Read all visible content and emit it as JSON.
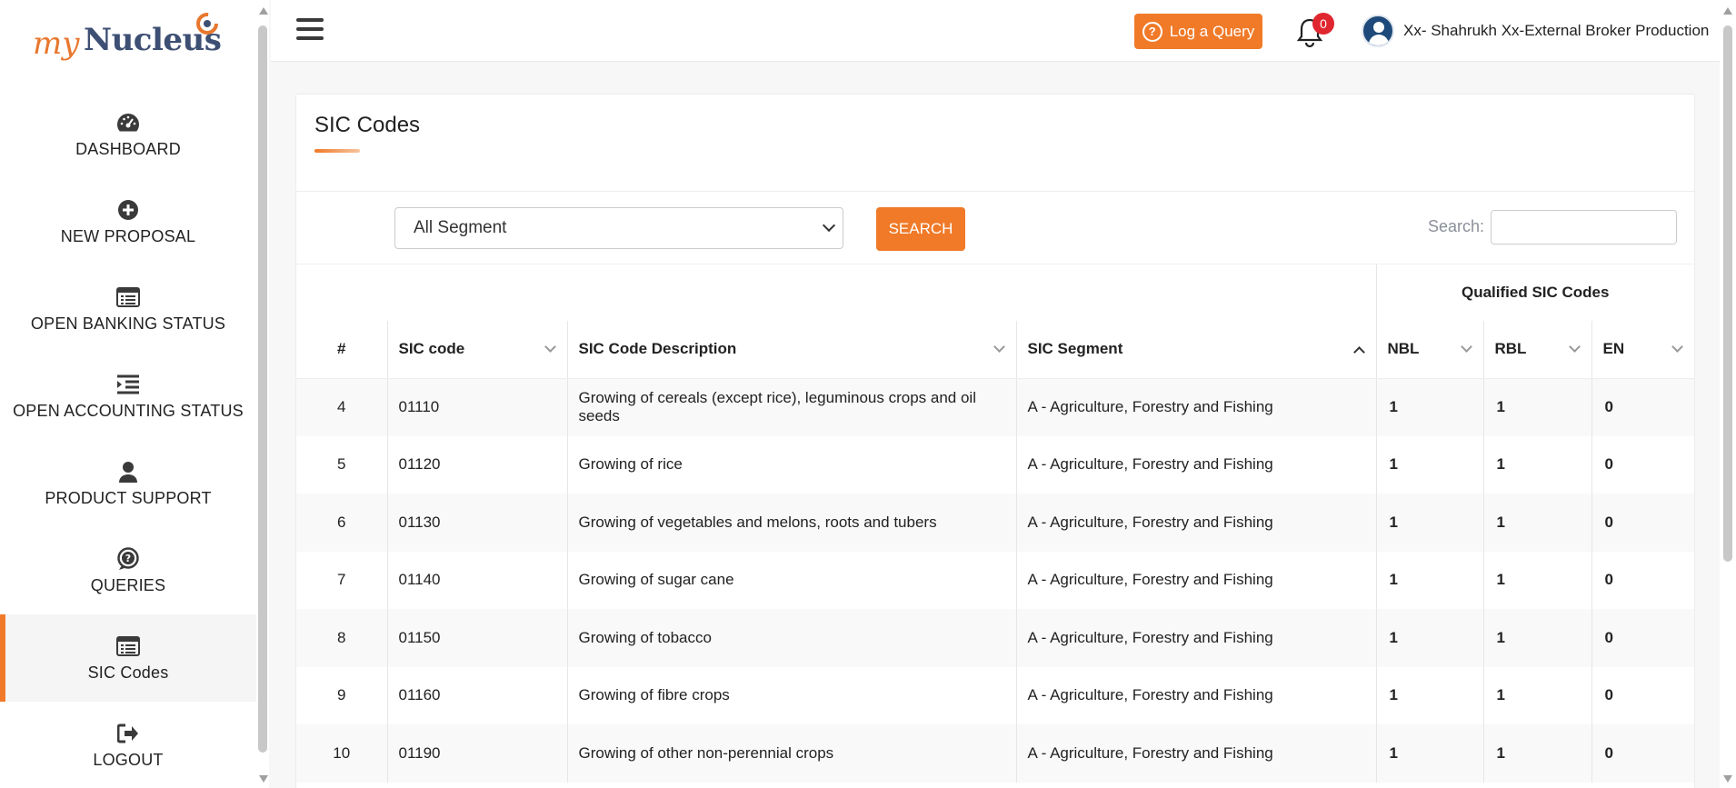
{
  "logo": {
    "part1": "my",
    "part2": "Nucleus"
  },
  "nav": [
    {
      "label": "DASHBOARD",
      "icon": "dashboard-gauge-icon",
      "active": false
    },
    {
      "label": "NEW PROPOSAL",
      "icon": "plus-circle-icon",
      "active": false
    },
    {
      "label": "OPEN BANKING STATUS",
      "icon": "list-card-icon",
      "active": false
    },
    {
      "label": "OPEN ACCOUNTING STATUS",
      "icon": "indent-list-icon",
      "active": false
    },
    {
      "label": "PRODUCT SUPPORT",
      "icon": "user-icon",
      "active": false
    },
    {
      "label": "QUERIES",
      "icon": "question-circle-icon",
      "active": false
    },
    {
      "label": "SIC Codes",
      "icon": "list-card-icon",
      "active": true
    },
    {
      "label": "LOGOUT",
      "icon": "sign-out-icon",
      "active": false
    }
  ],
  "topbar": {
    "query_button": "Log a Query",
    "notification_count": "0",
    "user_name": "Xx- Shahrukh Xx-External Broker Production"
  },
  "page": {
    "title": "SIC Codes",
    "segment_select": "All Segment",
    "search_button": "SEARCH",
    "search_label": "Search:",
    "search_value": ""
  },
  "table": {
    "group_header": "Qualified SIC Codes",
    "columns": [
      "#",
      "SIC code",
      "SIC Code Description",
      "SIC Segment",
      "NBL",
      "RBL",
      "EN"
    ],
    "rows": [
      [
        "4",
        "01110",
        "Growing of cereals (except rice), leguminous crops and oil seeds",
        "A - Agriculture, Forestry and Fishing",
        "1",
        "1",
        "0"
      ],
      [
        "5",
        "01120",
        "Growing of rice",
        "A - Agriculture, Forestry and Fishing",
        "1",
        "1",
        "0"
      ],
      [
        "6",
        "01130",
        "Growing of vegetables and melons, roots and tubers",
        "A - Agriculture, Forestry and Fishing",
        "1",
        "1",
        "0"
      ],
      [
        "7",
        "01140",
        "Growing of sugar cane",
        "A - Agriculture, Forestry and Fishing",
        "1",
        "1",
        "0"
      ],
      [
        "8",
        "01150",
        "Growing of tobacco",
        "A - Agriculture, Forestry and Fishing",
        "1",
        "1",
        "0"
      ],
      [
        "9",
        "01160",
        "Growing of fibre crops",
        "A - Agriculture, Forestry and Fishing",
        "1",
        "1",
        "0"
      ],
      [
        "10",
        "01190",
        "Growing of other non-perennial crops",
        "A - Agriculture, Forestry and Fishing",
        "1",
        "1",
        "0"
      ]
    ]
  },
  "colors": {
    "accent": "#f07a28",
    "brand_dark": "#3d4f73",
    "badge": "#e0262f"
  }
}
